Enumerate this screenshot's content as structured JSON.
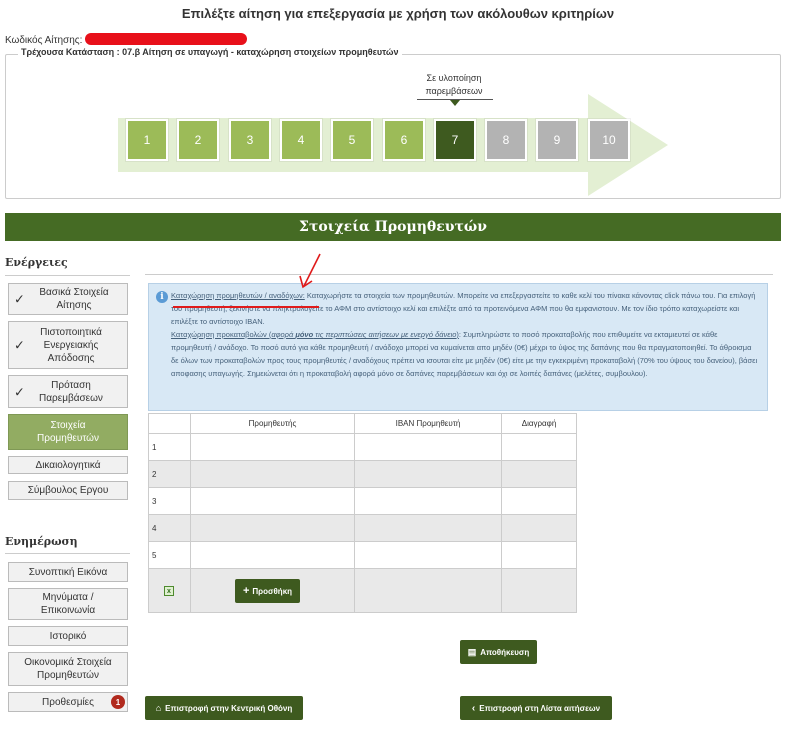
{
  "header": {
    "title": "Επιλέξτε αίτηση για επεξεργασία με χρήση των ακόλουθων κριτηρίων",
    "code_label": "Κωδικός Αίτησης:",
    "status_text": "Τρέχουσα Κατάσταση : 07.β Αίτηση σε υπαγωγή - καταχώρηση στοιχείων προμηθευτών"
  },
  "progress": {
    "tooltip": "Σε υλοποίηση παρεμβάσεων",
    "current_step": 7,
    "steps": [
      {
        "label": "1",
        "state": "done"
      },
      {
        "label": "2",
        "state": "done"
      },
      {
        "label": "3",
        "state": "done"
      },
      {
        "label": "4",
        "state": "done"
      },
      {
        "label": "5",
        "state": "done"
      },
      {
        "label": "6",
        "state": "done"
      },
      {
        "label": "7",
        "state": "current"
      },
      {
        "label": "8",
        "state": "pending"
      },
      {
        "label": "9",
        "state": "pending"
      },
      {
        "label": "10",
        "state": "pending"
      }
    ]
  },
  "section_title": "Στοιχεία Προμηθευτών",
  "sidebar": {
    "actions_heading": "Ενέργειες",
    "actions": [
      {
        "label": "Βασικά Στοιχεία Αίτησης",
        "checked": true
      },
      {
        "label": "Πιστοποιητικά Ενεργειακής Απόδοσης",
        "checked": true
      },
      {
        "label": "Πρόταση Παρεμβάσεων",
        "checked": true
      },
      {
        "label": "Στοιχεία Προμηθευτών",
        "active": true
      },
      {
        "label": "Δικαιολογητικά"
      },
      {
        "label": "Σύμβουλος Εργου"
      }
    ],
    "info_heading": "Ενημέρωση",
    "info_items": [
      {
        "label": "Συνοπτική Εικόνα"
      },
      {
        "label": "Μηνύματα / Επικοινωνία"
      },
      {
        "label": "Ιστορικό"
      },
      {
        "label": "Οικονομικά Στοιχεία Προμηθευτών"
      },
      {
        "label": "Προθεσμίες",
        "badge": "1"
      }
    ]
  },
  "info": {
    "p1_link": "Καταχώρηση προμηθευτών / αναδόχων:",
    "p1_text": " Καταχωρήστε τα στοιχεία των προμηθευτών. Μπορείτε να επεξεργαστείτε το καθε κελί του πίνακα κάνοντας click πάνω του. Για επιλογή του προμηθευτή, ξεκινήστε να πληκτρολογείτε το ΑΦΜ στο αντίστοιχο κελί και επιλέξτε από τα προτεινόμενα ΑΦΜ που θα εμφανιστουν. Με τον ίδιο τρόπο καταχωρείστε και επιλέξτε το αντίστοιχο IBAN.",
    "p2_link_a": "Καταχώρηση προκαταβολών (",
    "p2_link_b": "αφορά ",
    "p2_link_c": "μόνο",
    "p2_link_d": " τις περιπτώσεις αιτήσεων με ενεργό δάνειο",
    "p2_link_e": ")",
    "p2_text": ": Συμπληρώστε το ποσό προκαταβολής που επιθυμείτε να εκταμιευτεί σε κάθε προμηθευτή / ανάδοχο. Το ποσό αυτό για κάθε προμηθευτή / ανάδοχο μπορεί να κυμαίνεται απο μηδέν (0€) μέχρι το ύψος της δαπάνης που θα πραγματοποιηθεί. Το άθροισμα δε όλων των προκαταβολών προς τους προμηθευτές / αναδόχους πρέπει να ισουται είτε με μηδέν (0€) είτε με την εγκεκριμένη προκαταβολή (70% του ύψους του δανείου), βάσει αποφασης υπαγωγής. Σημειώνεται ότι η προκαταβολή αφορά μόνο σε δαπάνες παρεμβάσεων και όχι σε λοιπές δαπάνες (μελέτες, συμβουλου)."
  },
  "table": {
    "columns": [
      "",
      "Προμηθευτής",
      "IBAN Προμηθευτή",
      "Διαγραφή"
    ],
    "rows": [
      "1",
      "2",
      "3",
      "4",
      "5"
    ],
    "add_label": "Προσθήκη"
  },
  "buttons": {
    "save": "Αποθήκευση",
    "back_home": "Επιστροφή στην Κεντρική Οθόνη",
    "back_list": "Επιστροφή στη Λίστα αιτήσεων"
  },
  "colors": {
    "accent": "#456b24",
    "step_done": "#9cbb58",
    "step_current": "#3e5a1f",
    "step_pending": "#b3b3b3",
    "info_bg": "#d8e8f5",
    "annotation_red": "#e01b1b"
  }
}
